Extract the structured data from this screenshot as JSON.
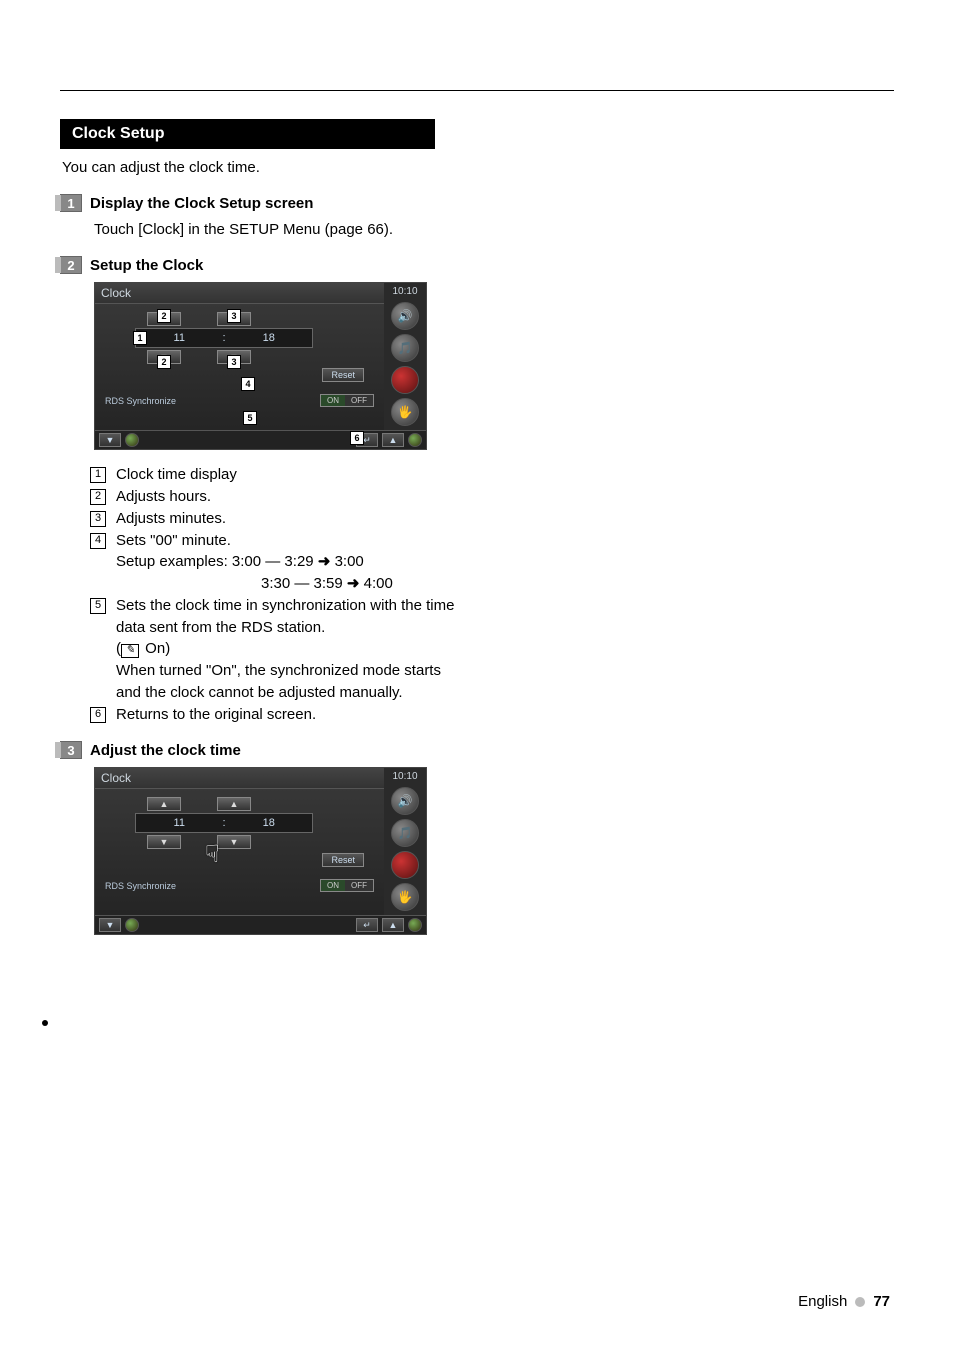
{
  "section": {
    "title": "Clock Setup",
    "intro": "You can adjust the clock time."
  },
  "steps": {
    "s1": {
      "num": "1",
      "title": "Display the Clock Setup screen",
      "body": "Touch [Clock] in the SETUP Menu (page 66)."
    },
    "s2": {
      "num": "2",
      "title": "Setup the Clock"
    },
    "s3": {
      "num": "3",
      "title": "Adjust the clock time"
    }
  },
  "ui": {
    "title": "Clock",
    "clock_top": "10:10",
    "hour": "11",
    "minute": "18",
    "reset": "Reset",
    "rds_label": "RDS Synchronize",
    "on": "ON",
    "off": "OFF"
  },
  "callouts": {
    "n1": "1",
    "n2": "2",
    "n3": "3",
    "n4": "4",
    "n5": "5",
    "n6": "6"
  },
  "legend": {
    "i1": {
      "n": "1",
      "t": "Clock time display"
    },
    "i2": {
      "n": "2",
      "t": "Adjusts hours."
    },
    "i3": {
      "n": "3",
      "t": "Adjusts minutes."
    },
    "i4": {
      "n": "4",
      "t": "Sets \"00\" minute.",
      "ex_label": "Setup examples:",
      "ex_a_l": "3:00 — 3:29",
      "ex_a_r": "3:00",
      "ex_b_l": "3:30 — 3:59",
      "ex_b_r": "4:00"
    },
    "i5": {
      "n": "5",
      "t1": "Sets the clock time in synchronization with the time data sent from the RDS station.",
      "default": "On",
      "t2": "When turned \"On\", the synchronized mode starts and the clock cannot be adjusted manually."
    },
    "i6": {
      "n": "6",
      "t": "Returns to the original screen."
    }
  },
  "footer": {
    "lang": "English",
    "page": "77"
  }
}
